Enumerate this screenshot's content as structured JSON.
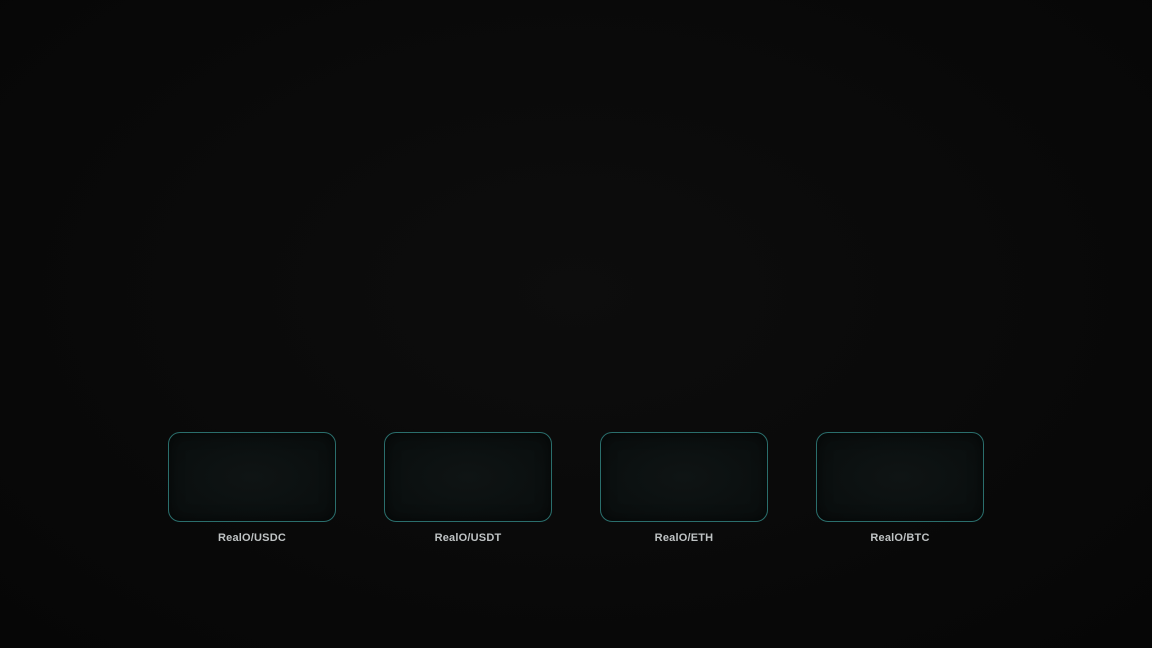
{
  "pairs": [
    {
      "label": "RealO/USDC"
    },
    {
      "label": "RealO/USDT"
    },
    {
      "label": "RealO/ETH"
    },
    {
      "label": "RealO/BTC"
    }
  ],
  "colors": {
    "background": "#080808",
    "card_border": "#2a6e6c",
    "label_text": "#bfc3c4"
  }
}
